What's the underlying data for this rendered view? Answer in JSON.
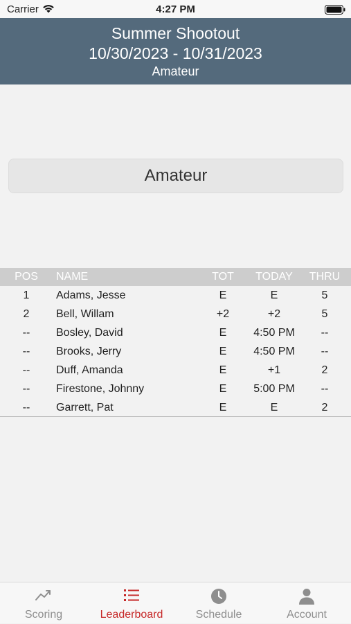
{
  "status_bar": {
    "carrier": "Carrier",
    "time": "4:27 PM"
  },
  "header": {
    "title": "Summer Shootout",
    "dates": "10/30/2023 - 10/31/2023",
    "division": "Amateur"
  },
  "division_selector": {
    "label": "Amateur"
  },
  "leaderboard": {
    "columns": {
      "pos": "POS",
      "name": "NAME",
      "tot": "TOT",
      "today": "TODAY",
      "thru": "THRU"
    },
    "rows": [
      {
        "pos": "1",
        "name": "Adams, Jesse",
        "tot": "E",
        "today": "E",
        "thru": "5"
      },
      {
        "pos": "2",
        "name": "Bell, Willam",
        "tot": "+2",
        "today": "+2",
        "thru": "5"
      },
      {
        "pos": "--",
        "name": "Bosley, David",
        "tot": "E",
        "today": "4:50 PM",
        "thru": "--"
      },
      {
        "pos": "--",
        "name": "Brooks, Jerry",
        "tot": "E",
        "today": "4:50 PM",
        "thru": "--"
      },
      {
        "pos": "--",
        "name": "Duff, Amanda",
        "tot": "E",
        "today": "+1",
        "thru": "2"
      },
      {
        "pos": "--",
        "name": "Firestone, Johnny",
        "tot": "E",
        "today": "5:00 PM",
        "thru": "--"
      },
      {
        "pos": "--",
        "name": "Garrett, Pat",
        "tot": "E",
        "today": "E",
        "thru": "2"
      }
    ]
  },
  "tab_bar": {
    "active_color": "#c62828",
    "inactive_color": "#8e8e8e",
    "tabs": [
      {
        "label": "Scoring",
        "icon": "trend-line-icon"
      },
      {
        "label": "Leaderboard",
        "icon": "list-icon",
        "active": true
      },
      {
        "label": "Schedule",
        "icon": "clock-icon"
      },
      {
        "label": "Account",
        "icon": "person-icon"
      }
    ]
  }
}
